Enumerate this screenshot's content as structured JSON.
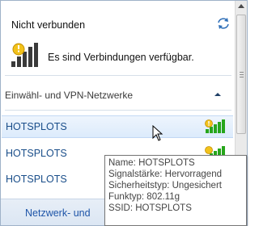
{
  "header": {
    "status": "Nicht verbunden",
    "available_text": "Es sind Verbindungen verfügbar."
  },
  "section": {
    "label": "Einwähl- und VPN-Netzwerke"
  },
  "networks": [
    {
      "name": "HOTSPLOTS",
      "signal": "excellent"
    },
    {
      "name": "HOTSPLOTS",
      "signal": "excellent"
    },
    {
      "name": "HOTSPLOTS",
      "signal": "excellent"
    }
  ],
  "footer": {
    "link_text": "Netzwerk- und"
  },
  "tooltip": {
    "name": "Name: HOTSPLOTS",
    "signal": "Signalstärke: Hervorragend",
    "security": "Sicherheitstyp: Ungesichert",
    "radio": "Funktyp: 802.11g",
    "ssid": "SSID: HOTSPLOTS"
  },
  "colors": {
    "link": "#1a4e8a",
    "signal_green": "#27a61c",
    "warning_yellow": "#f2c21b"
  }
}
